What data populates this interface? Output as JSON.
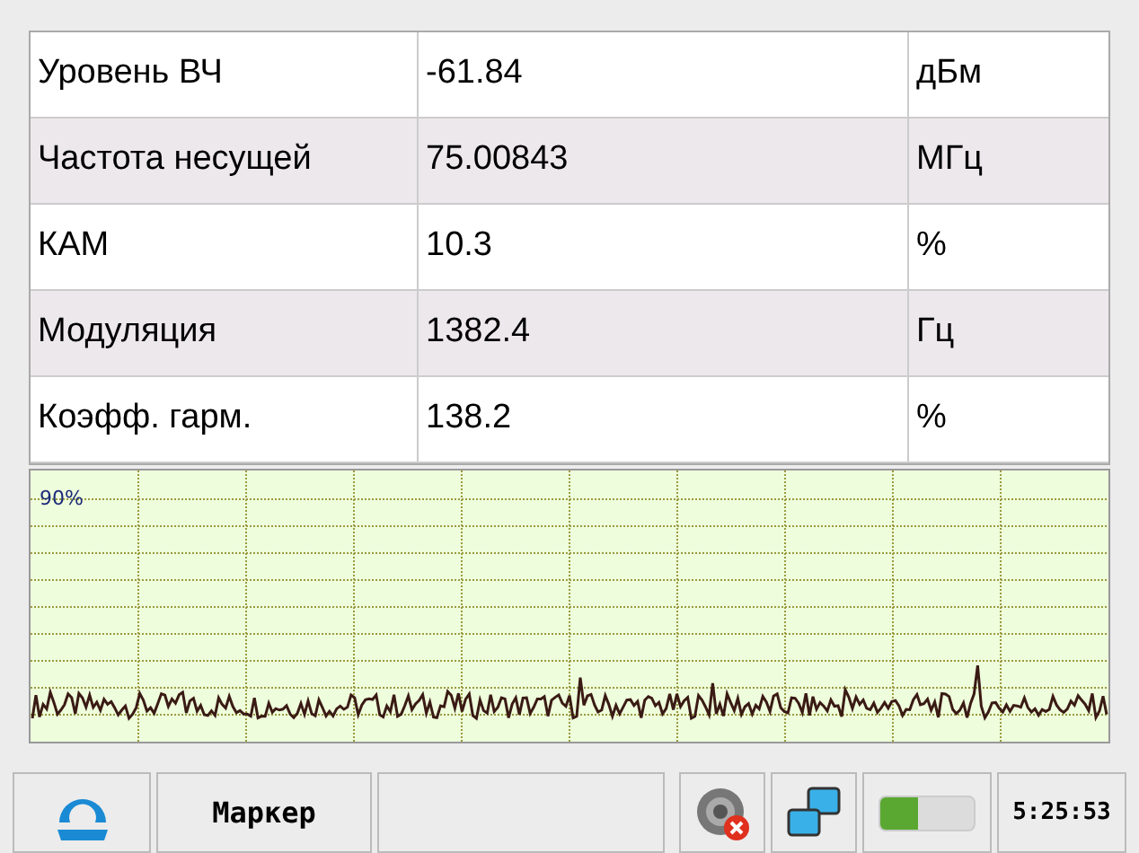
{
  "table": {
    "rows": [
      {
        "label": "Уровень ВЧ",
        "value": "-61.84",
        "unit": "дБм"
      },
      {
        "label": "Частота несущей",
        "value": "75.00843",
        "unit": "МГц"
      },
      {
        "label": "КАМ",
        "value": "10.3",
        "unit": "%"
      },
      {
        "label": "Модуляция",
        "value": "1382.4",
        "unit": "Гц"
      },
      {
        "label": "Коэфф. гарм.",
        "value": "138.2",
        "unit": "%"
      }
    ]
  },
  "scope": {
    "top_label": "90%"
  },
  "taskbar": {
    "marker_button": "Маркер",
    "sound_muted": true,
    "battery": {
      "level": 0.4
    },
    "clock": "5:25:53"
  }
}
